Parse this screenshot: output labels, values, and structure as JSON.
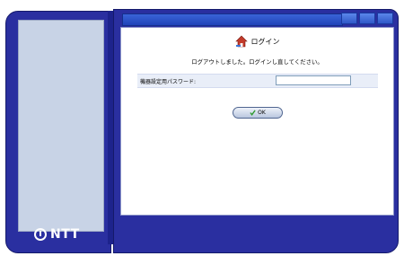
{
  "brand": {
    "logo_text": "NTT"
  },
  "dialog": {
    "title": "ログイン",
    "message": "ログアウトしました。ログインし直してください。",
    "password_label": "機器設定用パスワード:",
    "password_value": "",
    "ok_label": "OK"
  },
  "colors": {
    "frame": "#2a2fa0",
    "titlebar": "#1f43b8",
    "sidebar_panel": "#c8d3e6",
    "form_row": "#e9eef8"
  },
  "icons": {
    "title": "house-icon",
    "ok": "check-icon",
    "logo": "ntt-logo-icon"
  }
}
